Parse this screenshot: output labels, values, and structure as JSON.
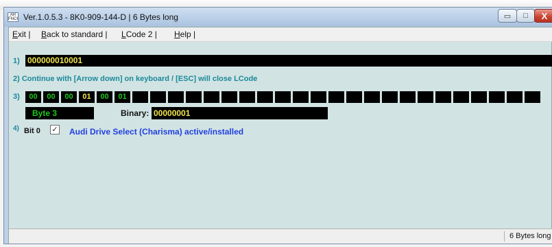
{
  "window": {
    "title": "Ver.1.0.5.3 -   8K0-909-144-D | 6 Bytes long",
    "icon_text": "AR FNCH",
    "buttons": {
      "minimize": "▭",
      "maximize": "□",
      "close": "X"
    }
  },
  "menu": {
    "items": [
      {
        "mnemonic": "E",
        "rest": "xit |"
      },
      {
        "mnemonic": "B",
        "rest": "ack to standard |"
      },
      {
        "mnemonic": "L",
        "rest": "Code 2 |"
      },
      {
        "mnemonic": "H",
        "rest": "elp |"
      }
    ]
  },
  "steps": {
    "s1": {
      "num": "1)",
      "code": "000000010001"
    },
    "s2": {
      "text": "2) Continue with [Arrow down] on keyboard / [ESC] will close LCode"
    },
    "s3": {
      "num": "3)",
      "bytes": [
        "00",
        "00",
        "00",
        "01",
        "00",
        "01"
      ],
      "selected_index": 3,
      "empty_cells": 23,
      "byte_label": "Byte 3",
      "binary_label": "Binary:",
      "binary_value": "00000001"
    },
    "s4": {
      "num": "4)",
      "bit_label": "Bit 0",
      "checked": true,
      "check_mark": "✓",
      "description": "Audi Drive Select (Charisma) active/installed"
    }
  },
  "statusbar": {
    "text": "6 Bytes long"
  },
  "colors": {
    "code_yellow": "#f2e64c",
    "byte_green": "#1cc91c",
    "step_teal": "#1a8a9a",
    "link_blue": "#1f3fe0"
  }
}
